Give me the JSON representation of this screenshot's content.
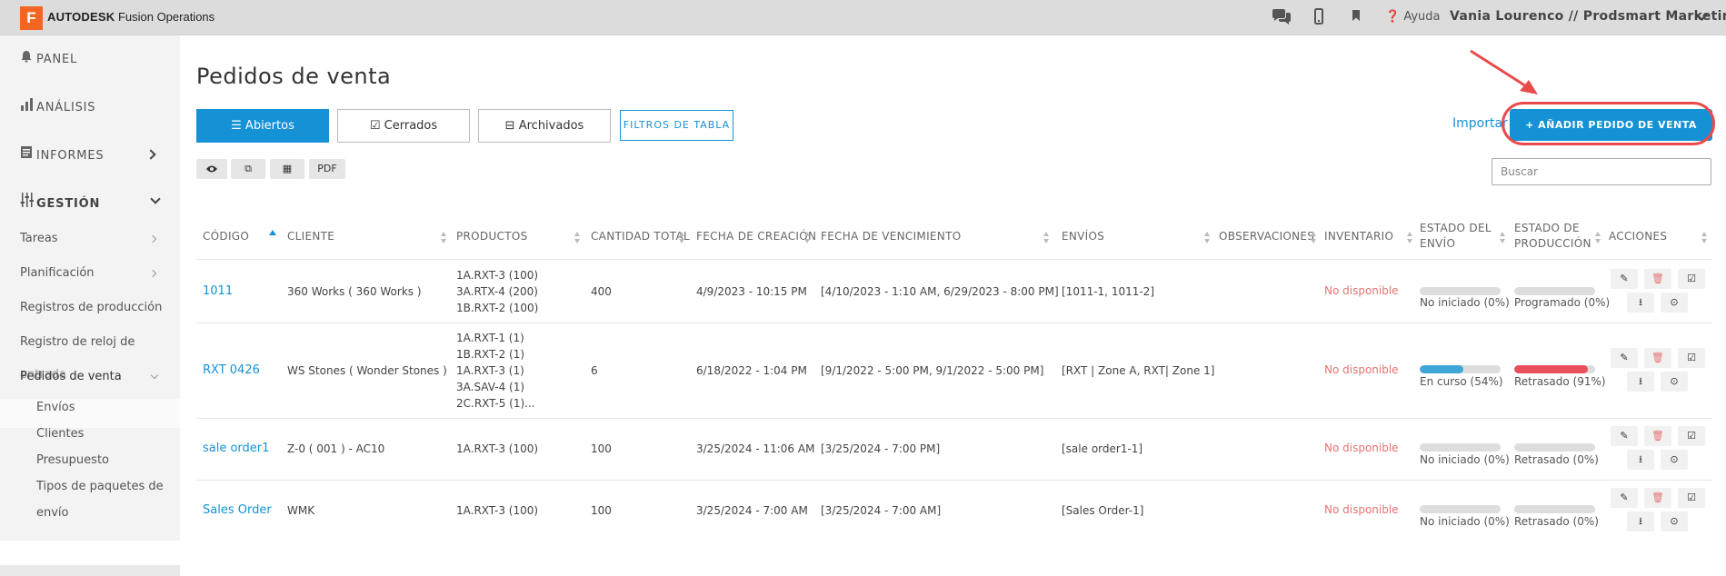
{
  "topbar": {
    "logo_letter": "F",
    "brand_bold": "AUTODESK",
    "brand_rest": "Fusion Operations",
    "help_label": "Ayuda",
    "user": "Vania Lourenco // Prodsmart Marketing"
  },
  "sidebar": {
    "panel": "PANEL",
    "analisis": "ANÁLISIS",
    "informes": "INFORMES",
    "gestion": "GESTIÓN",
    "tareas": "Tareas",
    "planificacion": "Planificación",
    "registros": "Registros de producción",
    "reloj_line1": "Registro de reloj de",
    "reloj_line2": "entrada",
    "pedidos": "Pedidos de venta",
    "envios": "Envíos",
    "clientes": "Clientes",
    "presupuesto": "Presupuesto",
    "paquetes_line1": "Tipos de paquetes de",
    "paquetes_line2": "envío"
  },
  "main": {
    "title": "Pedidos de venta",
    "tabs": [
      "Abiertos",
      "Cerrados",
      "Archivados"
    ],
    "filters": "FILTROS DE TABLA",
    "pdf": "PDF",
    "import": "Importar",
    "add": "+ AÑADIR PEDIDO DE VENTA",
    "search_placeholder": "Buscar"
  },
  "table": {
    "headers": {
      "codigo": "CÓDIGO",
      "cliente": "CLIENTE",
      "productos": "PRODUCTOS",
      "cantidad": "CANTIDAD TOTAL",
      "creacion": "FECHA DE CREACIÓN",
      "vencimiento": "FECHA DE VENCIMIENTO",
      "envios": "ENVÍOS",
      "observaciones": "OBSERVACIONES",
      "inventario": "INVENTARIO",
      "estado_envio_1": "ESTADO DEL",
      "estado_envio_2": "ENVÍO",
      "estado_prod_1": "ESTADO DE",
      "estado_prod_2": "PRODUCCIÓN",
      "acciones": "ACCIONES"
    },
    "rows": [
      {
        "code": "1011",
        "client": "360 Works ( 360 Works )",
        "products": [
          "1A.RXT-3 (100)",
          "3A.RTX-4 (200)",
          "1B.RXT-2 (100)"
        ],
        "qty": "400",
        "created": "4/9/2023 - 10:15 PM",
        "due": "[4/10/2023 - 1:10 AM, 6/29/2023 - 8:00 PM]",
        "shipments": "[1011-1, 1011-2]",
        "inventory": "No disponible",
        "ship_status": "No iniciado (0%)",
        "ship_pct": 0,
        "prod_status": "Programado (0%)",
        "prod_pct": 0
      },
      {
        "code": "RXT 0426",
        "client": "WS Stones ( Wonder Stones )",
        "products": [
          "1A.RXT-1 (1)",
          "1B.RXT-2 (1)",
          "1A.RXT-3 (1)",
          "3A.SAV-4 (1)",
          "2C.RXT-5 (1)..."
        ],
        "qty": "6",
        "created": "6/18/2022 - 1:04 PM",
        "due": "[9/1/2022 - 5:00 PM, 9/1/2022 - 5:00 PM]",
        "shipments": "[RXT | Zone A, RXT| Zone 1]",
        "inventory": "No disponible",
        "ship_status": "En curso (54%)",
        "ship_pct": 54,
        "prod_status": "Retrasado (91%)",
        "prod_pct": 91
      },
      {
        "code": "sale order1",
        "client": "Z-0 ( 001 ) - AC10",
        "products": [
          "1A.RXT-3 (100)"
        ],
        "qty": "100",
        "created": "3/25/2024 - 11:06 AM",
        "due": "[3/25/2024 - 7:00 PM]",
        "shipments": "[sale order1-1]",
        "inventory": "No disponible",
        "ship_status": "No iniciado (0%)",
        "ship_pct": 0,
        "prod_status": "Retrasado (0%)",
        "prod_pct": 0
      },
      {
        "code": "Sales Order",
        "client": "WMK",
        "products": [
          "1A.RXT-3 (100)"
        ],
        "qty": "100",
        "created": "3/25/2024 - 7:00 AM",
        "due": "[3/25/2024 - 7:00 AM]",
        "shipments": "[Sales Order-1]",
        "inventory": "No disponible",
        "ship_status": "No iniciado (0%)",
        "ship_pct": 0,
        "prod_status": "Retrasado (0%)",
        "prod_pct": 0
      }
    ]
  },
  "colors": {
    "accent": "#1592d6",
    "ship_bar": "#3fa7d6",
    "prod_bar_late": "#e8505b",
    "unavailable": "#e57373",
    "annotation": "#e94b4b"
  }
}
